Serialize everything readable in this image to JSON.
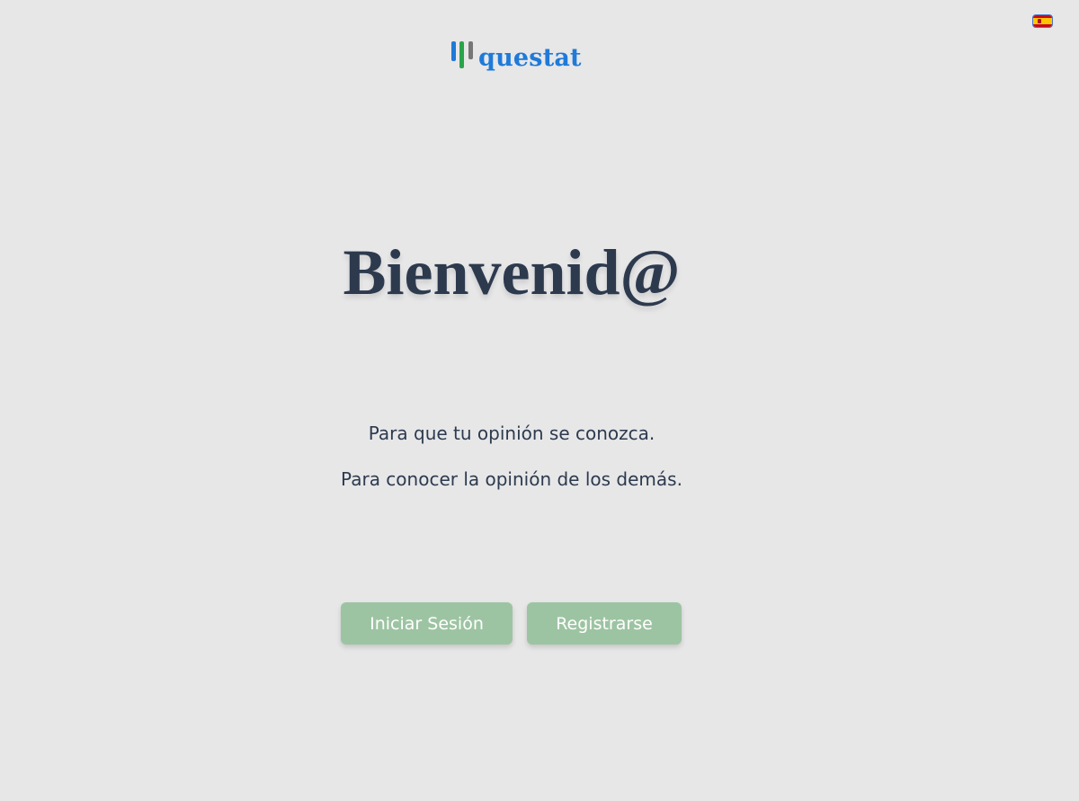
{
  "header": {
    "logo_text": "questat",
    "language_icon": "spain-flag-icon",
    "logo_icon": "bar-chart-logo-icon"
  },
  "hero": {
    "title": "Bienvenid@",
    "tagline_1": "Para que tu opinión se conozca.",
    "tagline_2": "Para conocer la opinión de los demás."
  },
  "actions": {
    "login_label": "Iniciar Sesión",
    "register_label": "Registrarse"
  },
  "colors": {
    "background": "#e7e7e8",
    "brand_blue": "#1f7ad8",
    "brand_green": "#2aa44a",
    "brand_gray": "#767676",
    "text_dark": "#2d3a4e",
    "button_green": "#9dc4a2"
  }
}
